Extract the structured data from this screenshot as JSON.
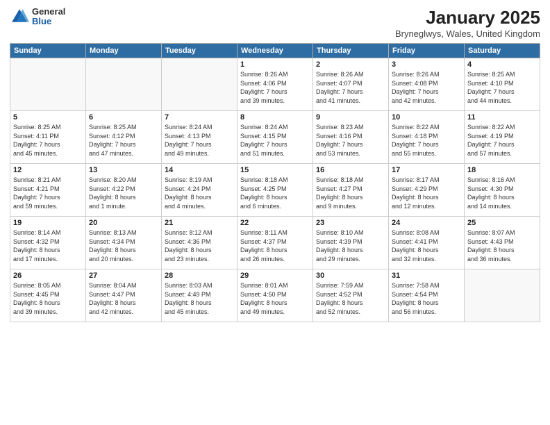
{
  "logo": {
    "general": "General",
    "blue": "Blue"
  },
  "title": "January 2025",
  "location": "Bryneglwys, Wales, United Kingdom",
  "days_header": [
    "Sunday",
    "Monday",
    "Tuesday",
    "Wednesday",
    "Thursday",
    "Friday",
    "Saturday"
  ],
  "weeks": [
    [
      {
        "day": "",
        "info": ""
      },
      {
        "day": "",
        "info": ""
      },
      {
        "day": "",
        "info": ""
      },
      {
        "day": "1",
        "info": "Sunrise: 8:26 AM\nSunset: 4:06 PM\nDaylight: 7 hours\nand 39 minutes."
      },
      {
        "day": "2",
        "info": "Sunrise: 8:26 AM\nSunset: 4:07 PM\nDaylight: 7 hours\nand 41 minutes."
      },
      {
        "day": "3",
        "info": "Sunrise: 8:26 AM\nSunset: 4:08 PM\nDaylight: 7 hours\nand 42 minutes."
      },
      {
        "day": "4",
        "info": "Sunrise: 8:25 AM\nSunset: 4:10 PM\nDaylight: 7 hours\nand 44 minutes."
      }
    ],
    [
      {
        "day": "5",
        "info": "Sunrise: 8:25 AM\nSunset: 4:11 PM\nDaylight: 7 hours\nand 45 minutes."
      },
      {
        "day": "6",
        "info": "Sunrise: 8:25 AM\nSunset: 4:12 PM\nDaylight: 7 hours\nand 47 minutes."
      },
      {
        "day": "7",
        "info": "Sunrise: 8:24 AM\nSunset: 4:13 PM\nDaylight: 7 hours\nand 49 minutes."
      },
      {
        "day": "8",
        "info": "Sunrise: 8:24 AM\nSunset: 4:15 PM\nDaylight: 7 hours\nand 51 minutes."
      },
      {
        "day": "9",
        "info": "Sunrise: 8:23 AM\nSunset: 4:16 PM\nDaylight: 7 hours\nand 53 minutes."
      },
      {
        "day": "10",
        "info": "Sunrise: 8:22 AM\nSunset: 4:18 PM\nDaylight: 7 hours\nand 55 minutes."
      },
      {
        "day": "11",
        "info": "Sunrise: 8:22 AM\nSunset: 4:19 PM\nDaylight: 7 hours\nand 57 minutes."
      }
    ],
    [
      {
        "day": "12",
        "info": "Sunrise: 8:21 AM\nSunset: 4:21 PM\nDaylight: 7 hours\nand 59 minutes."
      },
      {
        "day": "13",
        "info": "Sunrise: 8:20 AM\nSunset: 4:22 PM\nDaylight: 8 hours\nand 1 minute."
      },
      {
        "day": "14",
        "info": "Sunrise: 8:19 AM\nSunset: 4:24 PM\nDaylight: 8 hours\nand 4 minutes."
      },
      {
        "day": "15",
        "info": "Sunrise: 8:18 AM\nSunset: 4:25 PM\nDaylight: 8 hours\nand 6 minutes."
      },
      {
        "day": "16",
        "info": "Sunrise: 8:18 AM\nSunset: 4:27 PM\nDaylight: 8 hours\nand 9 minutes."
      },
      {
        "day": "17",
        "info": "Sunrise: 8:17 AM\nSunset: 4:29 PM\nDaylight: 8 hours\nand 12 minutes."
      },
      {
        "day": "18",
        "info": "Sunrise: 8:16 AM\nSunset: 4:30 PM\nDaylight: 8 hours\nand 14 minutes."
      }
    ],
    [
      {
        "day": "19",
        "info": "Sunrise: 8:14 AM\nSunset: 4:32 PM\nDaylight: 8 hours\nand 17 minutes."
      },
      {
        "day": "20",
        "info": "Sunrise: 8:13 AM\nSunset: 4:34 PM\nDaylight: 8 hours\nand 20 minutes."
      },
      {
        "day": "21",
        "info": "Sunrise: 8:12 AM\nSunset: 4:36 PM\nDaylight: 8 hours\nand 23 minutes."
      },
      {
        "day": "22",
        "info": "Sunrise: 8:11 AM\nSunset: 4:37 PM\nDaylight: 8 hours\nand 26 minutes."
      },
      {
        "day": "23",
        "info": "Sunrise: 8:10 AM\nSunset: 4:39 PM\nDaylight: 8 hours\nand 29 minutes."
      },
      {
        "day": "24",
        "info": "Sunrise: 8:08 AM\nSunset: 4:41 PM\nDaylight: 8 hours\nand 32 minutes."
      },
      {
        "day": "25",
        "info": "Sunrise: 8:07 AM\nSunset: 4:43 PM\nDaylight: 8 hours\nand 36 minutes."
      }
    ],
    [
      {
        "day": "26",
        "info": "Sunrise: 8:05 AM\nSunset: 4:45 PM\nDaylight: 8 hours\nand 39 minutes."
      },
      {
        "day": "27",
        "info": "Sunrise: 8:04 AM\nSunset: 4:47 PM\nDaylight: 8 hours\nand 42 minutes."
      },
      {
        "day": "28",
        "info": "Sunrise: 8:03 AM\nSunset: 4:49 PM\nDaylight: 8 hours\nand 45 minutes."
      },
      {
        "day": "29",
        "info": "Sunrise: 8:01 AM\nSunset: 4:50 PM\nDaylight: 8 hours\nand 49 minutes."
      },
      {
        "day": "30",
        "info": "Sunrise: 7:59 AM\nSunset: 4:52 PM\nDaylight: 8 hours\nand 52 minutes."
      },
      {
        "day": "31",
        "info": "Sunrise: 7:58 AM\nSunset: 4:54 PM\nDaylight: 8 hours\nand 56 minutes."
      },
      {
        "day": "",
        "info": ""
      }
    ]
  ]
}
